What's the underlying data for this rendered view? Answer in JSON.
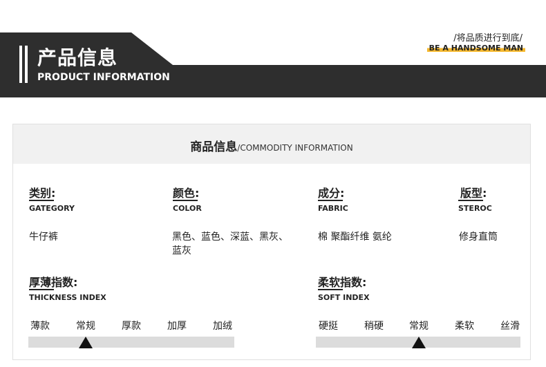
{
  "header": {
    "title_cn": "产品信息",
    "title_en": "PRODUCT INFORMATION",
    "slogan_cn": "/将品质进行到底/",
    "slogan_en": "BE A HANDSOME MAN",
    "accent_color": "#f5b82e",
    "bar_color": "#2e2e2e"
  },
  "card": {
    "title_cn": "商品信息",
    "title_en": "/COMMODITY INFORMATION"
  },
  "attributes": [
    {
      "label_cn": "类别:",
      "label_en": "GATEGORY",
      "value": "牛仔裤"
    },
    {
      "label_cn": "颜色:",
      "label_en": "COLOR",
      "value": "黑色、蓝色、深蓝、黑灰、蓝灰"
    },
    {
      "label_cn": "成分:",
      "label_en": "FABRIC",
      "value": "棉 聚酯纤维 氨纶"
    },
    {
      "label_cn": "版型:",
      "label_en": "STEROC",
      "value": "修身直筒"
    }
  ],
  "thickness": {
    "label_cn": "厚薄指数:",
    "label_en": "THICKNESS INDEX",
    "options": [
      "薄款",
      "常规",
      "厚款",
      "加厚",
      "加绒"
    ],
    "selected": "常规"
  },
  "softness": {
    "label_cn": "柔软指数:",
    "label_en": "SOFT INDEX",
    "options": [
      "硬挺",
      "稍硬",
      "常规",
      "柔软",
      "丝滑"
    ],
    "selected": "常规"
  }
}
